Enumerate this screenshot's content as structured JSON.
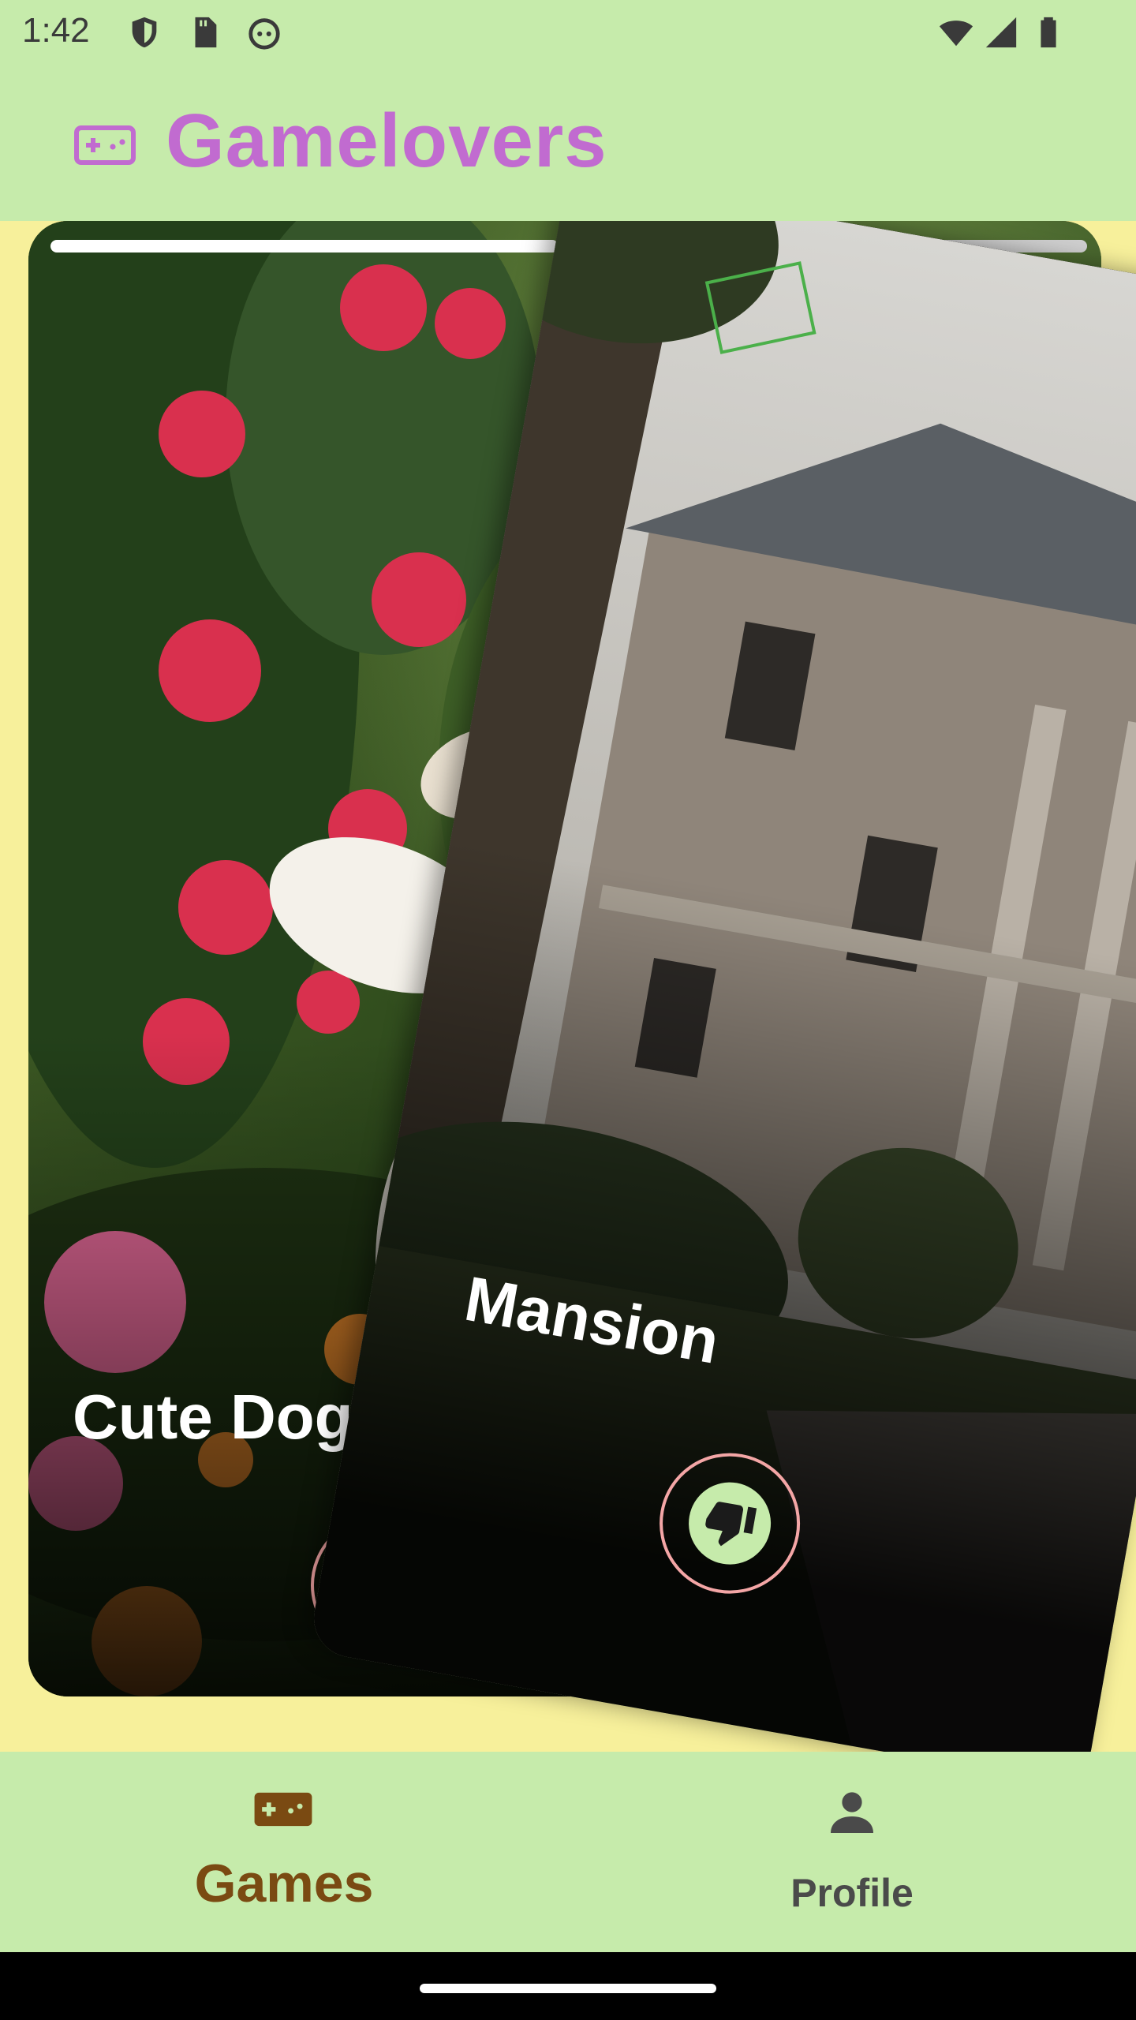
{
  "status_bar": {
    "time": "1:42",
    "icons": [
      "shield-icon",
      "sd-card-icon",
      "face-icon",
      "wifi-icon",
      "signal-icon",
      "battery-icon"
    ]
  },
  "app_bar": {
    "title": "Gamelovers",
    "logo_icon": "gamepad-icon"
  },
  "cards": [
    {
      "title": "Cute Dog",
      "image": "white puppy running in flower garden",
      "action_icon": "thumb-down-icon"
    },
    {
      "title": "Mansion",
      "image": "old mansion with columns",
      "action_icon": "thumb-down-icon"
    }
  ],
  "progress": {
    "segments": 2,
    "current": 1
  },
  "bottom_nav": {
    "items": [
      {
        "label": "Games",
        "icon": "gamepad-icon",
        "selected": true
      },
      {
        "label": "Profile",
        "icon": "person-icon",
        "selected": false
      }
    ]
  },
  "colors": {
    "app_bar_bg": "#C6EBAB",
    "content_bg": "#F7F09B",
    "title_color": "#C16BD0",
    "nav_selected": "#7A4A12",
    "button_ring": "#F4A6A6"
  }
}
